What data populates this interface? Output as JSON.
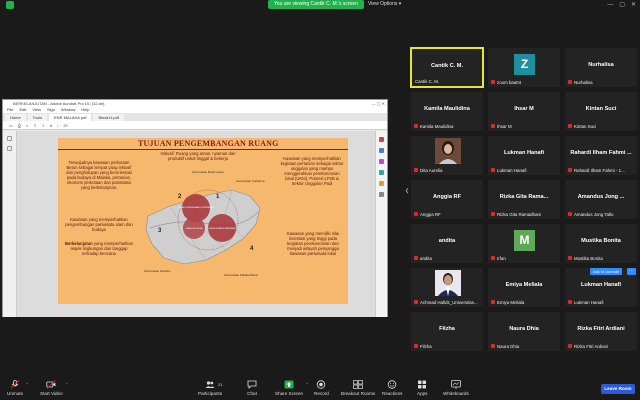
{
  "topbar": {
    "viewing_text": "You are viewing Cantik C. M.'s screen",
    "view_options": "View Options",
    "view_options_chevron": "▾",
    "minimize": "—",
    "maximize": "▢",
    "close": "✕"
  },
  "pdf": {
    "title": "BERKELANJUTAN - Adobe Acrobat Pro DC (32-bit)",
    "menu": [
      "File",
      "Edit",
      "View",
      "Sign",
      "Window",
      "Help"
    ],
    "tabs": [
      "Home",
      "Tools",
      "ENR MALAKA.pdf",
      "Binder1.pdf"
    ],
    "toolbar": [
      "6",
      "/",
      "20"
    ]
  },
  "slide": {
    "title": "TUJUAN PENGEMBANGAN RUANG",
    "center_top": "Inklusif: Ruang yang aman, nyaman dan produktif untuk tinggal & bekerja",
    "left_1": "Terwujudnya kawasan perkotaan Betun sebagai tempat yang inklusif dan penghidupan yang berorientasi pada budaya di Malaka, pertanian, ekonomi perkotaan dan pariwisata yang berkelanjutan.",
    "left_2": "Kawasan yang memperhatikan pengembangan pariwisata alam dan budaya",
    "left_3_bold": "Berkelanjutan",
    "left_3": " yang memperhatikan aspek lingkungan dan tanggap terhadap bencana",
    "right_1": "Kawasan yang memperhatikan kegiatan pertanian sebagai sektor unggulan yang mampu menggerakkan perekonomian lokal (UKM), Potensi LP2B & Sektor Unggulan Padi",
    "right_2": "Kawasan yang memiliki nilai investasi yang tinggi pada kegiatan perekonomian dan menjadi wilayah penyangga kawasan pariwisata lokal",
    "map_labels": {
      "north": "Kecamatan Bulat Lodoe",
      "east": "Kecamatan Kobalima",
      "southwest": "Kecamatan Wewiku",
      "south": "Kecamatan Malaka Barat",
      "num1": "1",
      "num2": "2",
      "num3": "3",
      "num4": "4",
      "circle_a": "RUANG KEBUDAYAAN & PERTANIAN",
      "circle_b": "RUANG EKONOMI",
      "circle_c": "RUANG HUNIAN & PARIWISATA"
    }
  },
  "gallery": [
    {
      "center": "Cantik C. M.",
      "foot": "Cantik C. M.",
      "active": true
    },
    {
      "avatar": "Z",
      "avatar_color": "#1f8e9e",
      "foot": "zoom baa04"
    },
    {
      "center": "Nurhalisa",
      "foot": "Nurhalisa"
    },
    {
      "center": "Kamila Maulidina",
      "foot": "Kamila Maulidina"
    },
    {
      "center": "Ihsar M",
      "foot": "Ihsar M"
    },
    {
      "center": "Kintan Suci",
      "foot": "Kintan Suci"
    },
    {
      "photo": "woman",
      "foot": "Dita Aurelia"
    },
    {
      "center": "Lukman Hanafi",
      "foot": "Lukman Hanafi"
    },
    {
      "center": "Rahardi Ilham Fahmi ...",
      "foot": "Rahardi Ilham Fahmi - 1..."
    },
    {
      "center": "Anggia RF",
      "foot": "Anggia RF"
    },
    {
      "center": "Rizka Gita Rama...",
      "foot": "Rizka Gita Ramadhani"
    },
    {
      "center": "Amandus Jong ...",
      "foot": "Amandus Jong Tallo"
    },
    {
      "center": "andita",
      "foot": "andita"
    },
    {
      "avatar": "M",
      "avatar_color": "#5fa85a",
      "foot": "Irfan"
    },
    {
      "center": "Mustika Bonita",
      "foot": "Mustika Bonita"
    },
    {
      "photo": "man",
      "foot": "Achmad Hafidz_Universitas..."
    },
    {
      "center": "Emiya Meliala",
      "foot": "Emiya Meliala"
    },
    {
      "center": "Lukman Hanafi",
      "foot": "Lukman Hanafi"
    },
    {
      "center": "Filzha",
      "foot": "Filzha"
    },
    {
      "center": "Naura Dhia",
      "foot": "Naura Dhia"
    },
    {
      "center": "Rizka Fitri Ardiani",
      "foot": "Rizka Fitri Ardiani"
    }
  ],
  "ask_unmute": "Ask to Unmute",
  "more": "···",
  "gallery_scroll": "❮",
  "toolbar": {
    "unmute": "Unmute",
    "start_video": "Start Video",
    "participants": "Participants",
    "participants_count": "21",
    "chat": "Chat",
    "share_screen": "Share Screen",
    "record": "Record",
    "breakout": "Breakout Rooms",
    "reactions": "Reactions",
    "apps": "Apps",
    "whiteboards": "Whiteboards",
    "leave": "Leave Room",
    "caret": "^"
  },
  "colors": {
    "accent_green": "#23b14d",
    "leave_blue": "#2d5bd8",
    "active_border": "#e6e632",
    "slide_bg": "#f6b86c",
    "slide_title": "#8a1b1b"
  }
}
